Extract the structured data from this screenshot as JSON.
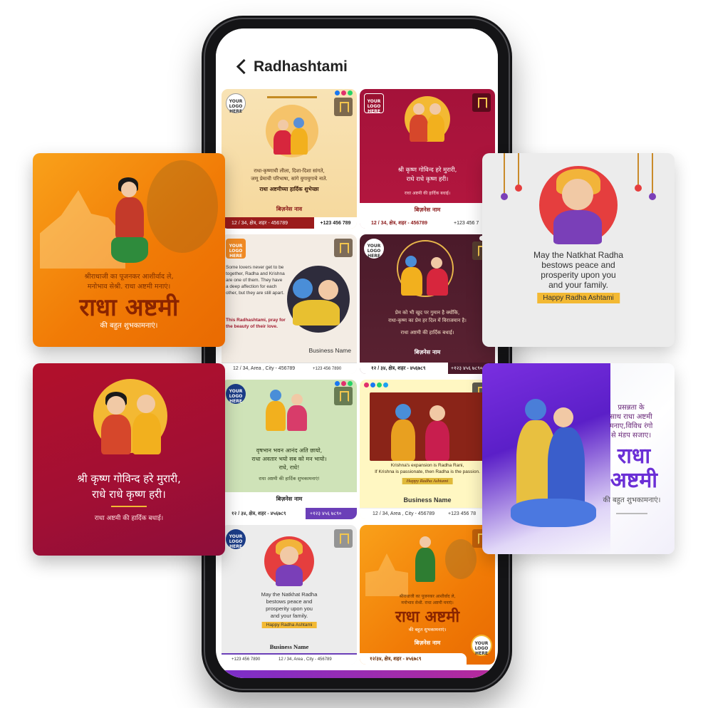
{
  "screen": {
    "title": "Radhashtami"
  },
  "cards": {
    "c1": {
      "logo": "YOUR LOGO HERE",
      "line1": "राधा-कृष्णाची लीला, दिशा-दिशा सांगते,",
      "line2": "जणू प्रेमाची परिभाषा, सांगे युगायुगाचे नाते.",
      "headline": "राधा अष्टमीच्या हार्दिक शुभेच्छा",
      "business": "बिज़नेस नाव",
      "address": "12 / 34, क्षेत्र, शहर - 456789",
      "phone": "+123 456 789"
    },
    "c2": {
      "logo": "YOUR LOGO HERE",
      "line1": "श्री कृष्ण गोविन्द हरे मुरारी,",
      "line2": "राधे राधे कृष्ण हरी।",
      "line3": "राधा अष्टमी की हार्दिक बधाई।",
      "business": "बिज़नेस नाम",
      "address": "12 / 34, क्षेत्र, शहर - 456789",
      "phone": "+123 456 7"
    },
    "c3": {
      "logo": "YOUR LOGO HERE",
      "body": "Some lovers never get to be together, Radha and Krishna are one of them. They have a deep affection for each other, but they are still apart.",
      "highlight": "This Radhashtami, pray for the beauty of their love.",
      "business": "Business Name",
      "address": "12 / 34, Area , City - 456789",
      "phone": "+123 456 7890"
    },
    "c4": {
      "logo": "YOUR LOGO HERE",
      "line1": "प्रेम को भी खुद पर गुमान है क्योंकि,",
      "line2": "राधा-कृष्ण का प्रेम हर दिल में विराजमान है।",
      "line3": "राधा अष्टमी की हार्दिक बधाई।",
      "business": "बिज़नेस नाम",
      "address": "१२ / ३४, क्षेत्र, शहर - ४५६७८९",
      "phone": "+१२३ ४५६ ७८९०"
    },
    "c5": {
      "logo": "YOUR LOGO HERE",
      "line1": "वृषभान भवन आनंद अति छायो,",
      "line2": "राधा अवतार भयो सब को मन भायो।",
      "line3": "राधे, राधे!",
      "line4": "राधा अष्टमी की हार्दिक शुभकामनाएं!",
      "business": "बिज़नेस नाम",
      "address": "१२ / ३४, क्षेत्र, शहर - ४५६७८९",
      "phone": "+१२३ ४५६ ७८९०"
    },
    "c6": {
      "line1": "Krishna's expansion is Radha Rani,",
      "line2": "If Krishna is passionate, then Radha is the passion.",
      "badge": "Happy Radha Ashtami",
      "business": "Business Name",
      "address": "12 / 34, Area , City - 456789",
      "phone": "+123 456 78"
    },
    "c7": {
      "logo": "YOUR LOGO HERE",
      "line1": "May the Natkhat Radha",
      "line2": "bestows peace and",
      "line3": "prosperity upon you",
      "line4": "and your family.",
      "badge": "Happy Radha Ashtami",
      "business": "Business Name",
      "phone": "+123 456 7890",
      "address": "12 / 34, Area , City - 456789"
    },
    "c8": {
      "line1": "श्रीराधाजी का पूजनकर आशीर्वाद ले,",
      "line2": "मनोभाव सेश्री. राधा अष्टमी मनाएं।",
      "headline": "राधा अष्टमी",
      "sub": "की बहुत शुभकामनाएं।",
      "business": "बिज़नेस नाम",
      "address": "१२/३४, क्षेत्र, शहर - ४५६७८९",
      "logo": "YOUR LOGO HERE"
    }
  },
  "previews": {
    "left1": {
      "line1": "श्रीराधाजी का पूजनकर आशीर्वाद ले,",
      "line2": "मनोभाव सेश्री. राधा अष्टमी मनाएं।",
      "headline": "राधा अष्टमी",
      "sub": "की बहुत शुभकामनाएं।"
    },
    "left2": {
      "line1": "श्री कृष्ण गोविन्द हरे मुरारी,",
      "line2": "राधे राधे कृष्ण हरी।",
      "line3": "राधा अष्टमी की हार्दिक बधाई।"
    },
    "right1": {
      "line1": "May the Natkhat Radha",
      "line2": "bestows peace and",
      "line3": "prosperity upon you",
      "line4": "and your family.",
      "badge": "Happy Radha Ashtami"
    },
    "right2": {
      "line1": "प्रसन्नता के",
      "line2": "साथ राधा अष्टमी",
      "line3": "मनाए,विविध रंगो",
      "line4": "से मंडप सजाए।",
      "headline1": "राधा",
      "headline2": "अष्टमी",
      "sub": "की बहुत शुभकामनाएं।"
    }
  },
  "colors": {
    "maroon": "#9a1030",
    "orange": "#f17b06",
    "purple": "#6b2fd6",
    "gold": "#f3b933"
  }
}
